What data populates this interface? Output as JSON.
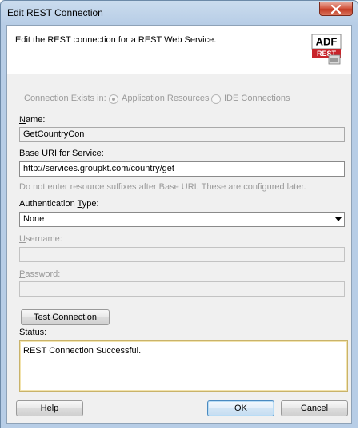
{
  "window": {
    "title": "Edit REST Connection"
  },
  "header": {
    "description": "Edit the REST connection for a REST Web Service.",
    "logo_top": "ADF",
    "logo_bottom": "REST"
  },
  "connection_exists": {
    "label": "Connection Exists in:",
    "options": [
      "Application Resources",
      "IDE Connections"
    ],
    "selected": "Application Resources"
  },
  "name": {
    "label_u": "N",
    "label_rest": "ame:",
    "value": "GetCountryCon"
  },
  "base_uri": {
    "label_u": "B",
    "label_rest": "ase URI for Service:",
    "value": "http://services.groupkt.com/country/get",
    "hint": "Do not enter resource suffixes after Base URI. These are configured later."
  },
  "auth": {
    "label_pre": "Authentication ",
    "label_u": "T",
    "label_rest": "ype:",
    "value": "None"
  },
  "username": {
    "label_u": "U",
    "label_rest": "sername:",
    "value": ""
  },
  "password": {
    "label_u": "P",
    "label_rest": "assword:",
    "value": ""
  },
  "test_button": {
    "label_pre": "Test ",
    "label_u": "C",
    "label_rest": "onnection"
  },
  "status": {
    "label": "Status:",
    "value": "REST Connection Successful."
  },
  "footer": {
    "help_u": "H",
    "help_rest": "elp",
    "ok": "OK",
    "cancel": "Cancel"
  }
}
